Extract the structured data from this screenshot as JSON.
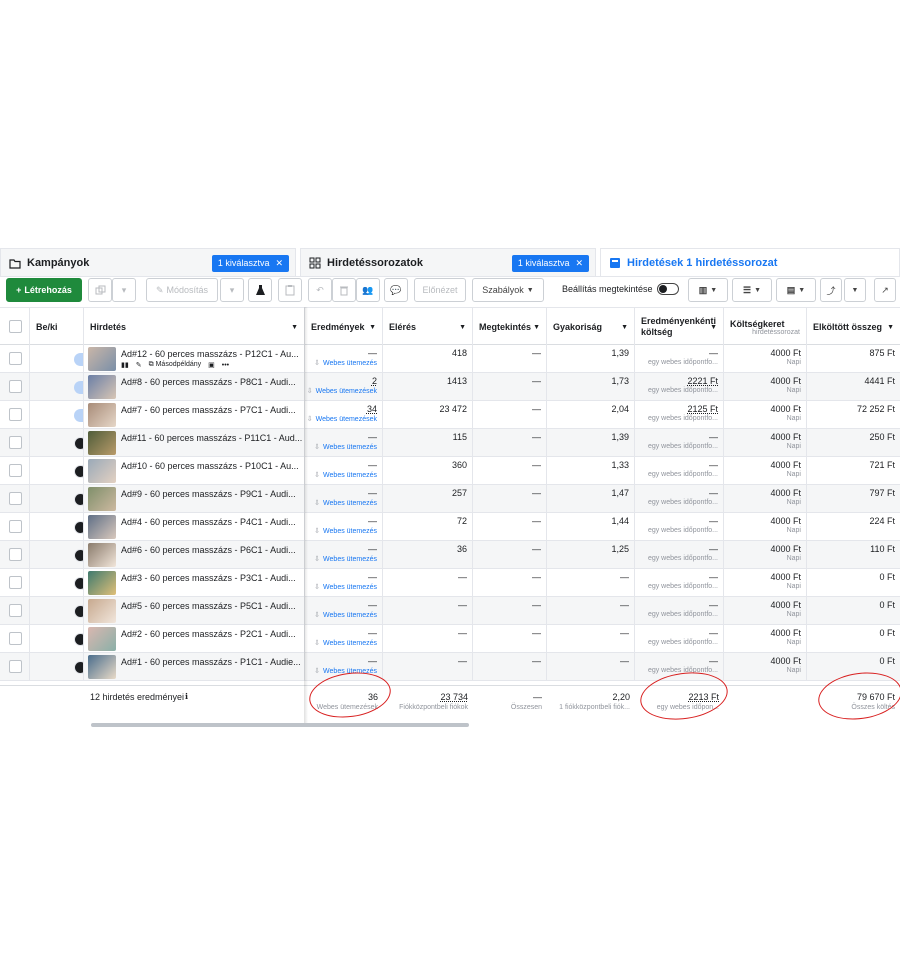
{
  "tabs": [
    {
      "label": "Kampányok",
      "chip": "1 kiválasztva"
    },
    {
      "label": "Hirdetéssorozatok",
      "chip": "1 kiválasztva"
    },
    {
      "label": "Hirdetések 1 hirdetéssorozat"
    }
  ],
  "toolbar": {
    "create": "Létrehozás",
    "edit": "Módosítás",
    "preview": "Előnézet",
    "rules": "Szabályok",
    "settings_view": "Beállítás megtekintése"
  },
  "columns": {
    "onoff": "Be/ki",
    "ad": "Hirdetés",
    "results": "Eredmények",
    "reach": "Elérés",
    "impressions": "Megtekintés",
    "frequency": "Gyakoriság",
    "cost_per_result": "Eredményenkénti költség",
    "budget": "Költségkeret",
    "budget_sub": "hirdetéssorozat",
    "spent": "Elköltött összeg"
  },
  "row_tools": {
    "duplicate": "Másodpéldány"
  },
  "rows": [
    {
      "on": true,
      "name": "Ad#12 - 60 perces masszázs - P12C1 - Au...",
      "results": "—",
      "results_sub": "Webes ütemezés",
      "reach": "418",
      "impr": "—",
      "freq": "1,39",
      "cpr": "—",
      "cpr_sub": "egy webes időpontfo...",
      "budget": "4000 Ft",
      "budget_sub": "Napi",
      "spent": "875 Ft"
    },
    {
      "on": true,
      "name": "Ad#8 - 60 perces masszázs - P8C1 - Audi...",
      "results": "2",
      "results_sub": "Webes ütemezések",
      "reach": "1413",
      "impr": "—",
      "freq": "1,73",
      "cpr": "2221 Ft",
      "cpr_sub": "egy webes időpontfo...",
      "budget": "4000 Ft",
      "budget_sub": "Napi",
      "spent": "4441 Ft"
    },
    {
      "on": true,
      "name": "Ad#7 - 60 perces masszázs - P7C1 - Audi...",
      "results": "34",
      "results_sub": "Webes ütemezések",
      "reach": "23 472",
      "impr": "—",
      "freq": "2,04",
      "cpr": "2125 Ft",
      "cpr_sub": "egy webes időpontfo...",
      "budget": "4000 Ft",
      "budget_sub": "Napi",
      "spent": "72 252 Ft"
    },
    {
      "on": false,
      "name": "Ad#11 - 60 perces masszázs - P11C1 - Aud...",
      "results": "—",
      "results_sub": "Webes ütemezés",
      "reach": "115",
      "impr": "—",
      "freq": "1,39",
      "cpr": "—",
      "cpr_sub": "egy webes időpontfo...",
      "budget": "4000 Ft",
      "budget_sub": "Napi",
      "spent": "250 Ft"
    },
    {
      "on": false,
      "name": "Ad#10 - 60 perces masszázs - P10C1 - Au...",
      "results": "—",
      "results_sub": "Webes ütemezés",
      "reach": "360",
      "impr": "—",
      "freq": "1,33",
      "cpr": "—",
      "cpr_sub": "egy webes időpontfo...",
      "budget": "4000 Ft",
      "budget_sub": "Napi",
      "spent": "721 Ft"
    },
    {
      "on": false,
      "name": "Ad#9 - 60 perces masszázs - P9C1 - Audi...",
      "results": "—",
      "results_sub": "Webes ütemezés",
      "reach": "257",
      "impr": "—",
      "freq": "1,47",
      "cpr": "—",
      "cpr_sub": "egy webes időpontfo...",
      "budget": "4000 Ft",
      "budget_sub": "Napi",
      "spent": "797 Ft"
    },
    {
      "on": false,
      "name": "Ad#4 - 60 perces masszázs - P4C1 - Audi...",
      "results": "—",
      "results_sub": "Webes ütemezés",
      "reach": "72",
      "impr": "—",
      "freq": "1,44",
      "cpr": "—",
      "cpr_sub": "egy webes időpontfo...",
      "budget": "4000 Ft",
      "budget_sub": "Napi",
      "spent": "224 Ft"
    },
    {
      "on": false,
      "name": "Ad#6 - 60 perces masszázs - P6C1 - Audi...",
      "results": "—",
      "results_sub": "Webes ütemezés",
      "reach": "36",
      "impr": "—",
      "freq": "1,25",
      "cpr": "—",
      "cpr_sub": "egy webes időpontfo...",
      "budget": "4000 Ft",
      "budget_sub": "Napi",
      "spent": "110 Ft"
    },
    {
      "on": false,
      "name": "Ad#3 - 60 perces masszázs - P3C1 - Audi...",
      "results": "—",
      "results_sub": "Webes ütemezés",
      "reach": "—",
      "impr": "—",
      "freq": "—",
      "cpr": "—",
      "cpr_sub": "egy webes időpontfo...",
      "budget": "4000 Ft",
      "budget_sub": "Napi",
      "spent": "0 Ft"
    },
    {
      "on": false,
      "name": "Ad#5 - 60 perces masszázs - P5C1 - Audi...",
      "results": "—",
      "results_sub": "Webes ütemezés",
      "reach": "—",
      "impr": "—",
      "freq": "—",
      "cpr": "—",
      "cpr_sub": "egy webes időpontfo...",
      "budget": "4000 Ft",
      "budget_sub": "Napi",
      "spent": "0 Ft"
    },
    {
      "on": false,
      "name": "Ad#2 - 60 perces masszázs - P2C1 - Audi...",
      "results": "—",
      "results_sub": "Webes ütemezés",
      "reach": "—",
      "impr": "—",
      "freq": "—",
      "cpr": "—",
      "cpr_sub": "egy webes időpontfo...",
      "budget": "4000 Ft",
      "budget_sub": "Napi",
      "spent": "0 Ft"
    },
    {
      "on": false,
      "name": "Ad#1 - 60 perces masszázs - P1C1 - Audie...",
      "results": "—",
      "results_sub": "Webes ütemezés",
      "reach": "—",
      "impr": "—",
      "freq": "—",
      "cpr": "—",
      "cpr_sub": "egy webes időpontfo...",
      "budget": "4000 Ft",
      "budget_sub": "Napi",
      "spent": "0 Ft"
    }
  ],
  "footer": {
    "label": "12 hirdetés eredményei",
    "results": "36",
    "results_sub": "Webes ütemezések",
    "reach": "23 734",
    "reach_sub": "Fiókközpontbeli fiókok",
    "impr_sub": "Összesen",
    "freq": "2,20",
    "freq_sub": "1 fiókközpontbeli fiók...",
    "cpr": "2213 Ft",
    "cpr_sub": "egy webes időpon...",
    "spent": "79 670 Ft",
    "spent_sub": "Összes költés"
  },
  "colors": {
    "accent": "#1877f2",
    "create": "#1f8a3c",
    "annotation": "#d81f1f"
  }
}
